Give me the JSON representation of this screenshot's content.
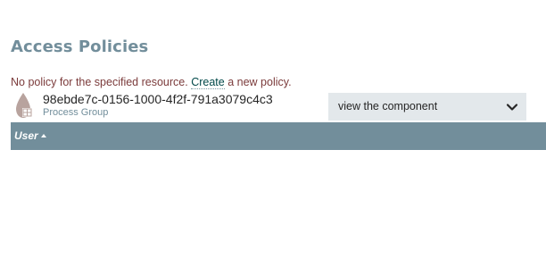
{
  "page": {
    "title": "Access Policies"
  },
  "message": {
    "text": "No policy for the specified resource.",
    "create_link": "Create",
    "suffix": "a new policy."
  },
  "component": {
    "id": "98ebde7c-0156-1000-4f2f-791a3079c4c3",
    "type": "Process Group",
    "icon": "process-group-icon"
  },
  "action_select": {
    "selected": "view the component",
    "icon": "chevron-down-icon"
  },
  "table": {
    "columns": [
      {
        "label": "User",
        "sort": "ascending"
      }
    ],
    "rows": []
  },
  "colors": {
    "title": "#728e9b",
    "header_bg": "#728e9b",
    "message": "#7b3b3b",
    "link": "#004849",
    "select_bg": "#e3e8eb"
  }
}
